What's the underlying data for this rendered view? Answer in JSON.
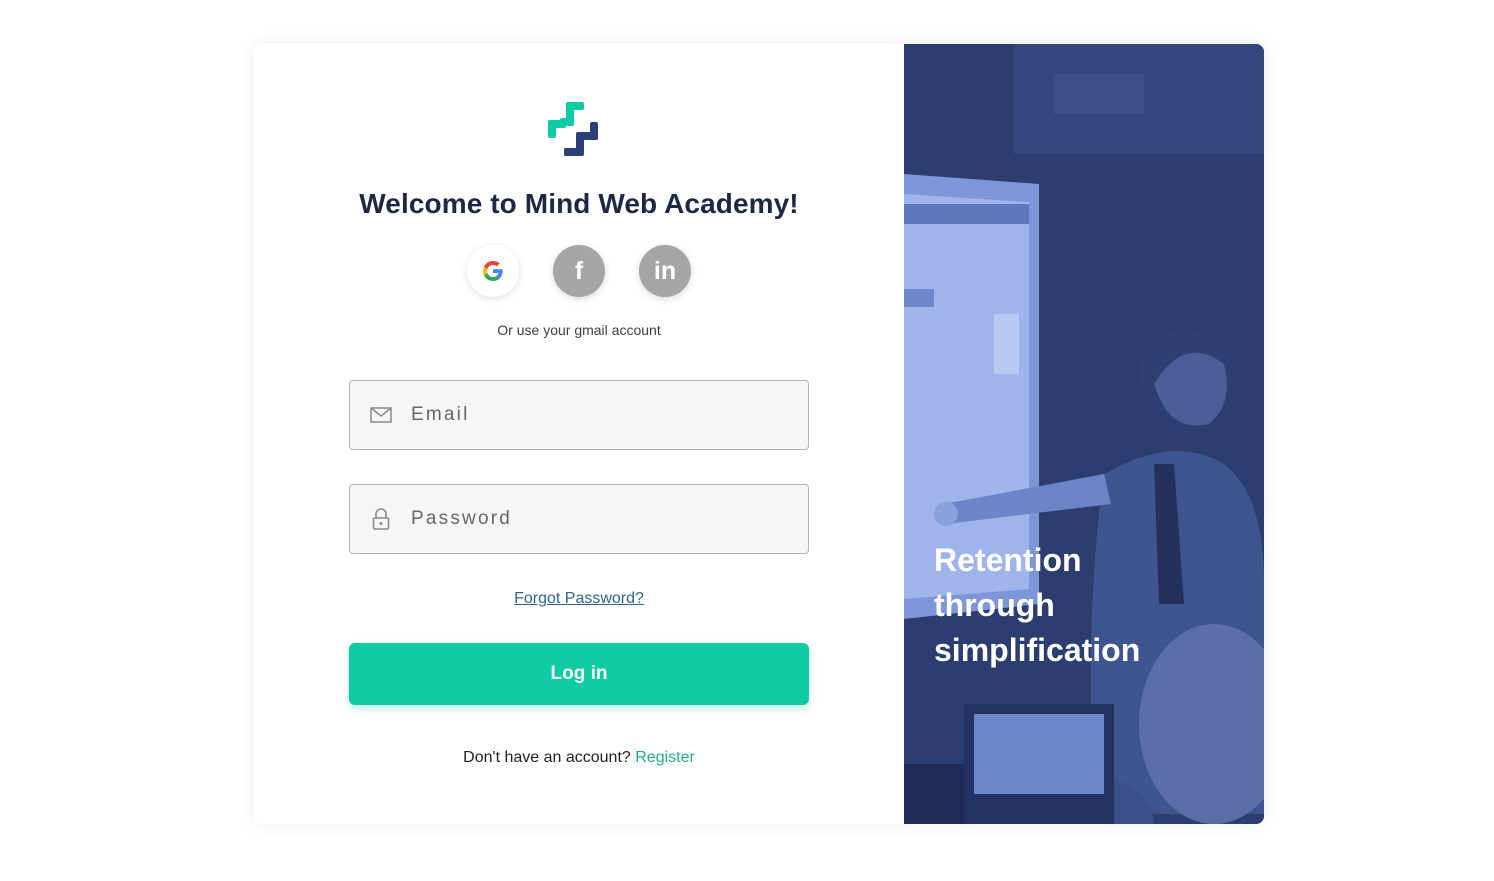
{
  "heading": "Welcome to Mind Web Academy!",
  "social": {
    "google_icon": "google-icon",
    "facebook_glyph": "f",
    "linkedin_glyph": "in"
  },
  "subtitle": "Or use your gmail account",
  "form": {
    "email_placeholder": "Email",
    "email_value": "",
    "password_placeholder": "Password",
    "password_value": "",
    "forgot_label": "Forgot Password?",
    "login_label": "Log in"
  },
  "register": {
    "prompt": "Don't have an account?",
    "link": "Register"
  },
  "hero": {
    "tagline_lines": [
      "Retention",
      "through",
      "simplification"
    ]
  },
  "colors": {
    "primary": "#0ecba5",
    "heading": "#1d2844",
    "link": "#2f6296",
    "register_link": "#21a98e",
    "hero_overlay": "#2d3f72"
  }
}
